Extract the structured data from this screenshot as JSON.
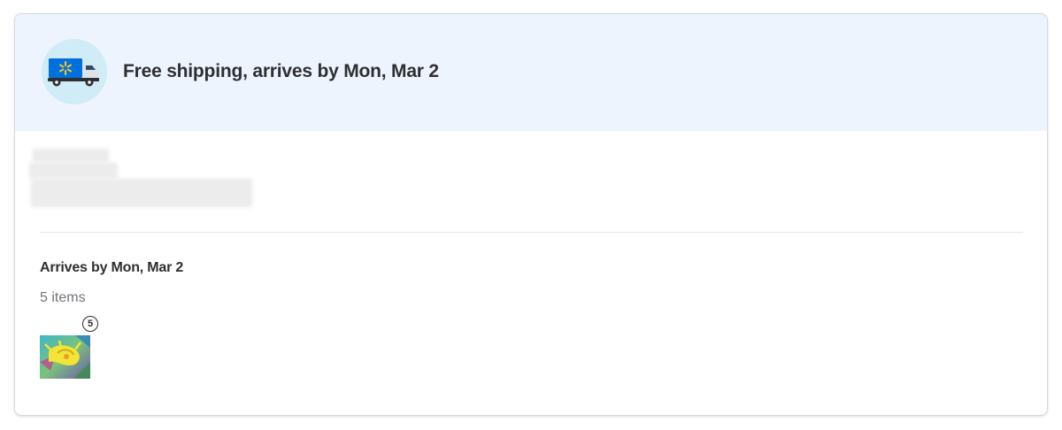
{
  "shipping": {
    "title": "Free shipping, arrives by Mon, Mar 2",
    "icon": "delivery-truck-icon"
  },
  "address": {
    "redacted": true
  },
  "delivery_group": {
    "arrives_label": "Arrives by Mon, Mar 2",
    "items_count": "5 items",
    "quantity_badge": "5",
    "thumbnail_icon": "product-thumbnail"
  },
  "colors": {
    "header_bg": "#eef4fe",
    "truck_circle": "#cfecf7",
    "brand_blue": "#0071dc",
    "spark_yellow": "#ffc220",
    "text_primary": "#2e2f32",
    "text_secondary": "#74767c"
  }
}
